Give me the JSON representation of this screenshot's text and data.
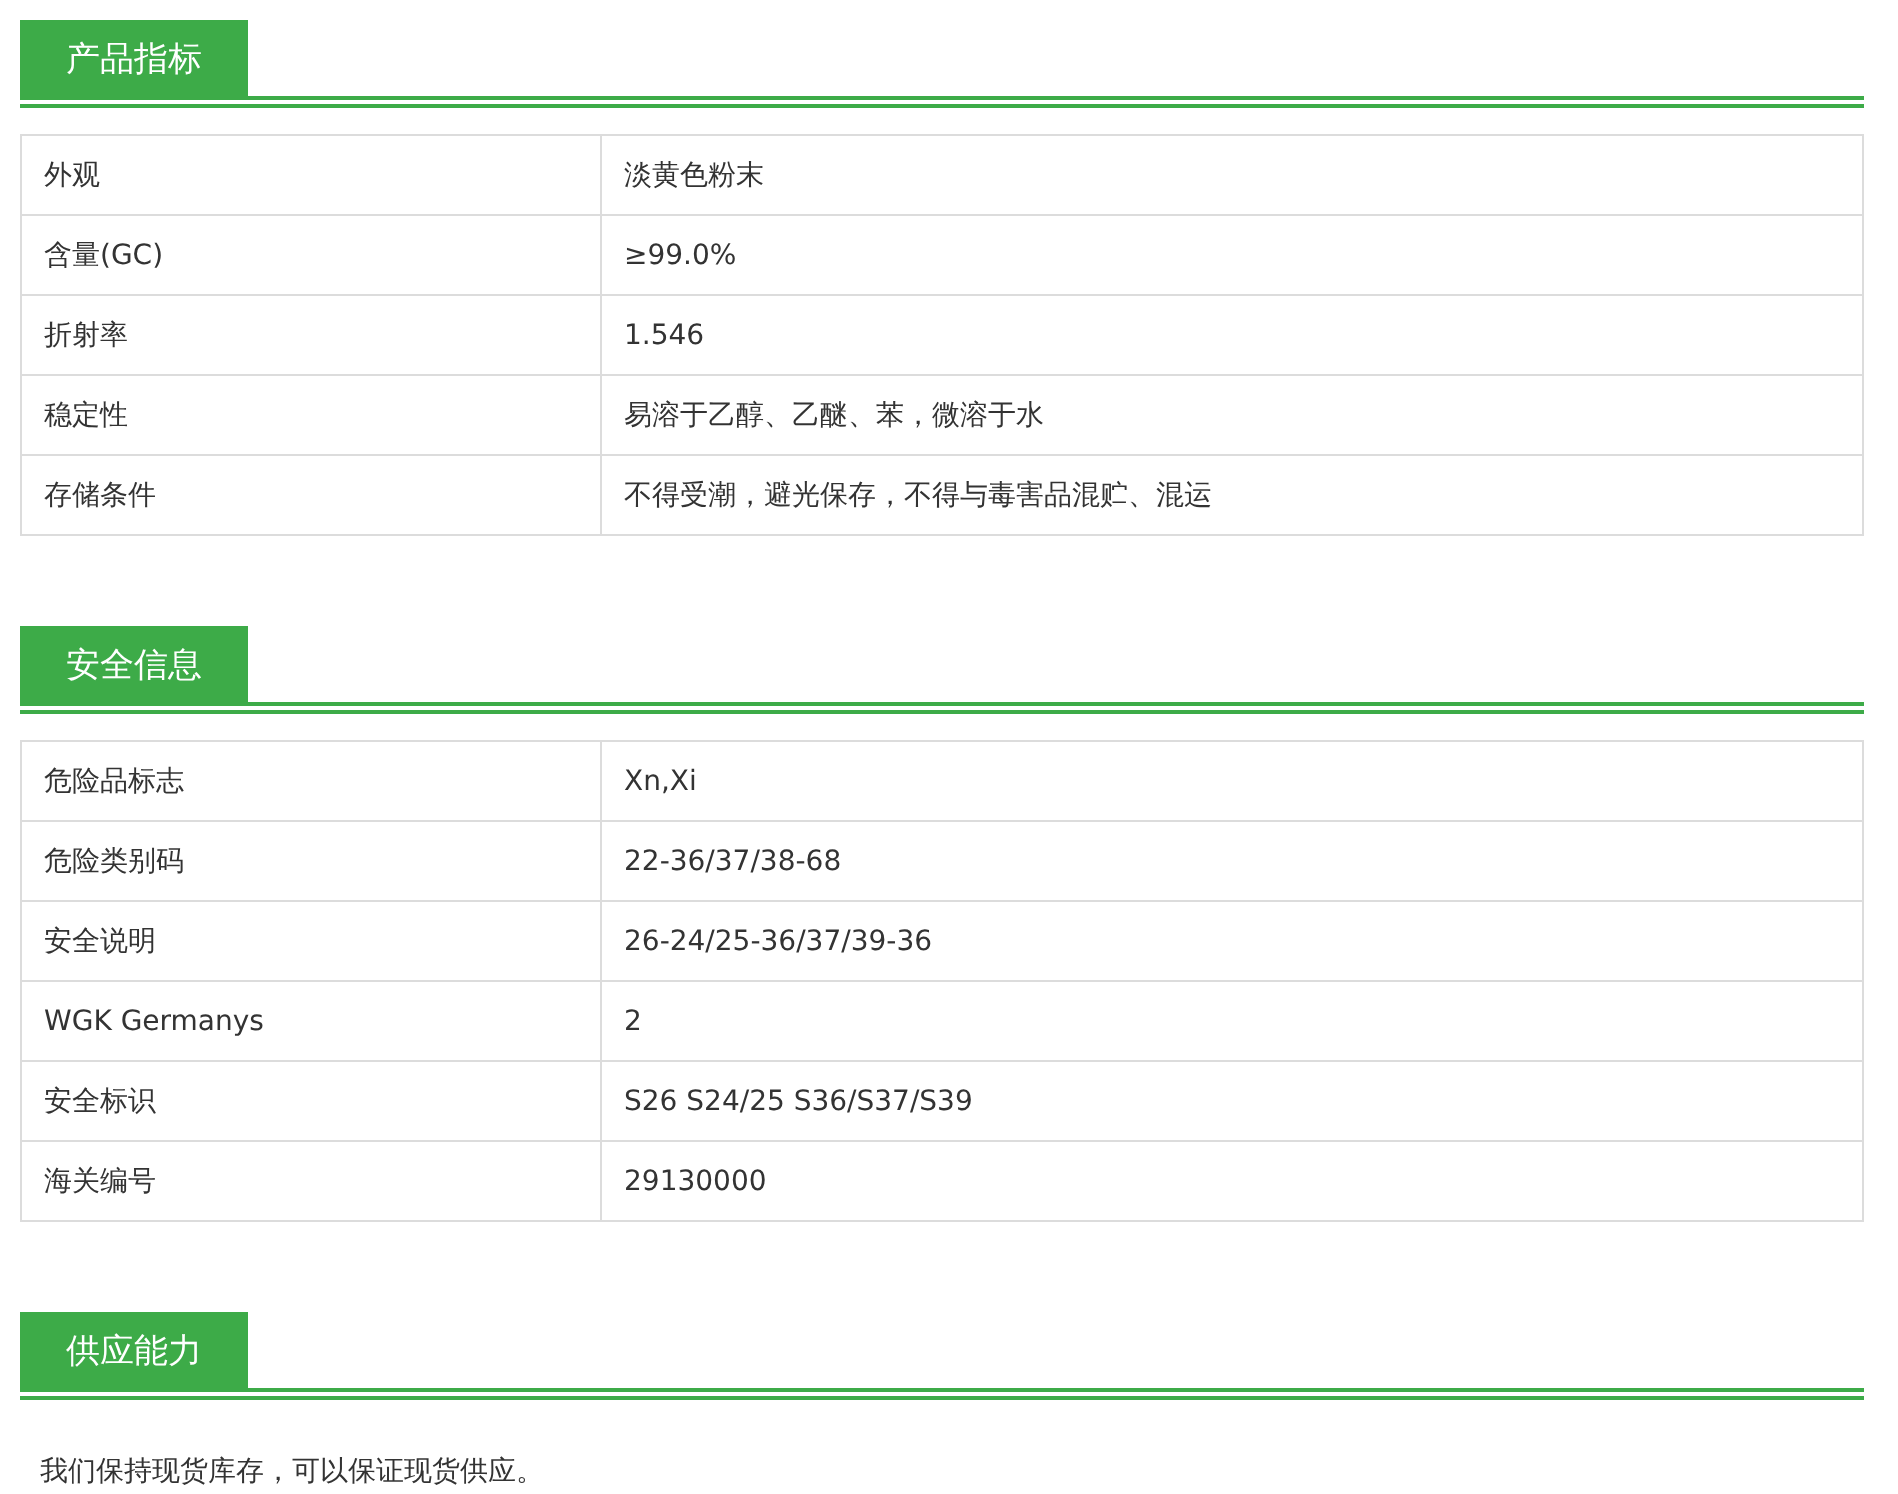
{
  "sections": [
    {
      "title": "产品指标",
      "kind": "table",
      "rows": [
        {
          "label": "外观",
          "value": "淡黄色粉末"
        },
        {
          "label": "含量(GC)",
          "value": "≥99.0%"
        },
        {
          "label": "折射率",
          "value": "1.546"
        },
        {
          "label": "稳定性",
          "value": "易溶于乙醇、乙醚、苯，微溶于水"
        },
        {
          "label": "存储条件",
          "value": "不得受潮，避光保存，不得与毒害品混贮、混运"
        }
      ]
    },
    {
      "title": "安全信息",
      "kind": "table",
      "rows": [
        {
          "label": "危险品标志",
          "value": "Xn,Xi"
        },
        {
          "label": "危险类别码",
          "value": "22-36/37/38-68"
        },
        {
          "label": "安全说明",
          "value": "26-24/25-36/37/39-36"
        },
        {
          "label": "WGK Germanys",
          "value": "2"
        },
        {
          "label": "安全标识",
          "value": "S26 S24/25 S36/S37/S39"
        },
        {
          "label": "海关编号",
          "value": "29130000"
        }
      ]
    },
    {
      "title": "供应能力",
      "kind": "text",
      "text": "我们保持现货库存，可以保证现货供应。"
    }
  ]
}
